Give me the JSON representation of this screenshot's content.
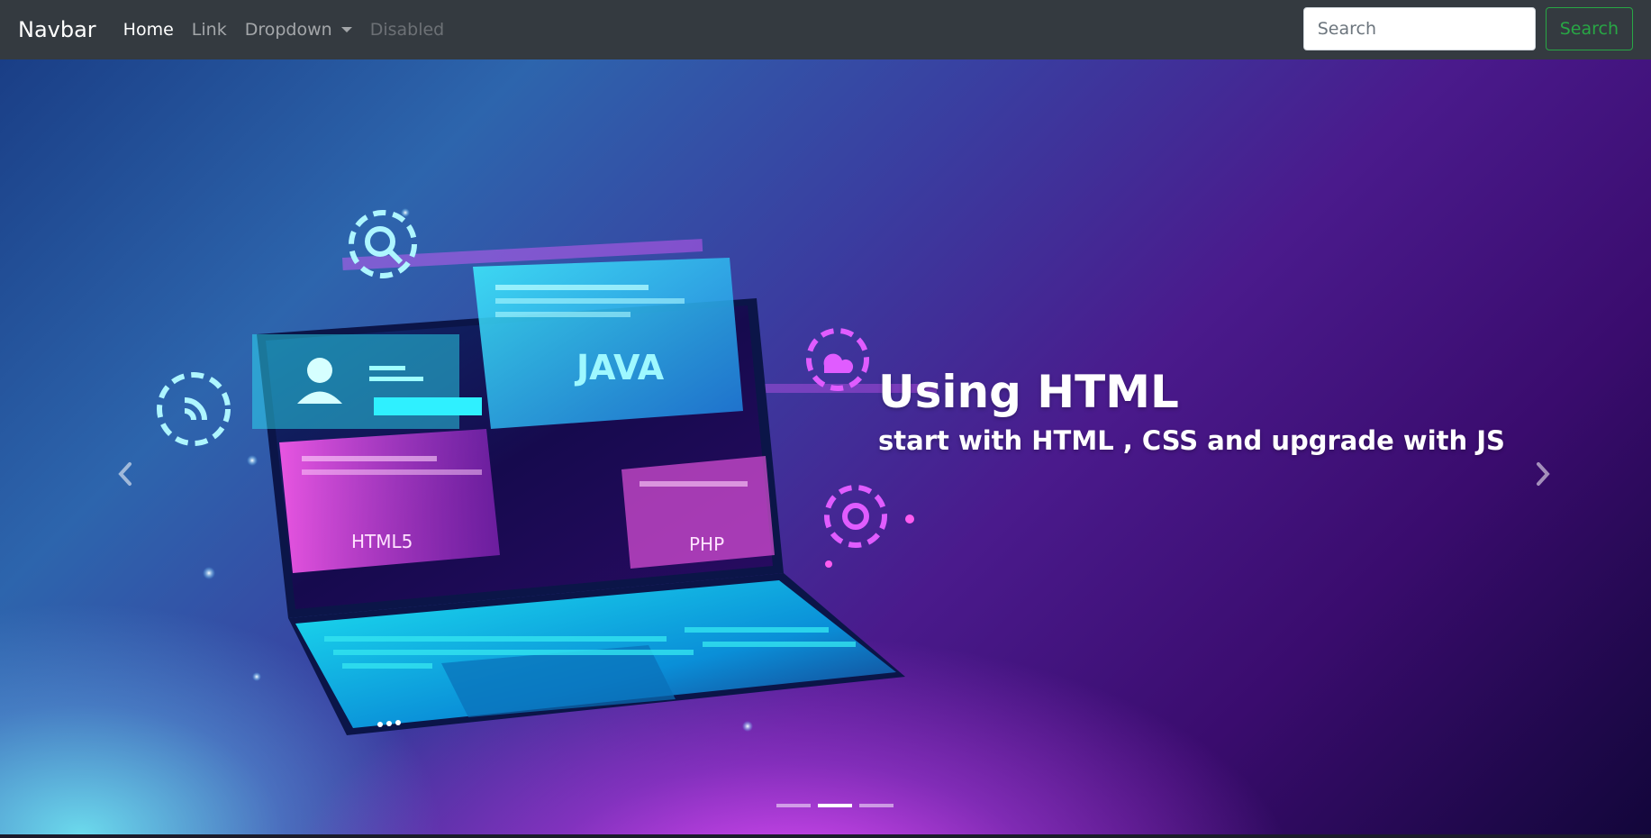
{
  "navbar": {
    "brand": "Navbar",
    "links": [
      {
        "label": "Home"
      },
      {
        "label": "Link"
      },
      {
        "label": "Dropdown"
      },
      {
        "label": "Disabled"
      }
    ],
    "search": {
      "placeholder": "Search",
      "button_label": "Search"
    }
  },
  "carousel": {
    "caption_title": "Using HTML",
    "caption_text": "start with HTML , CSS and upgrade with JS",
    "illustration": {
      "java": "JAVA",
      "html5": "HTML5",
      "php": "PHP"
    },
    "indicators": [
      {
        "active": false
      },
      {
        "active": true
      },
      {
        "active": false
      }
    ],
    "prev_icon": "chevron-left-icon",
    "next_icon": "chevron-right-icon"
  },
  "colors": {
    "navbar_bg": "#343a40",
    "search_green": "#28a745",
    "neon_cyan": "#35f0ff",
    "neon_magenta": "#e05cff"
  }
}
